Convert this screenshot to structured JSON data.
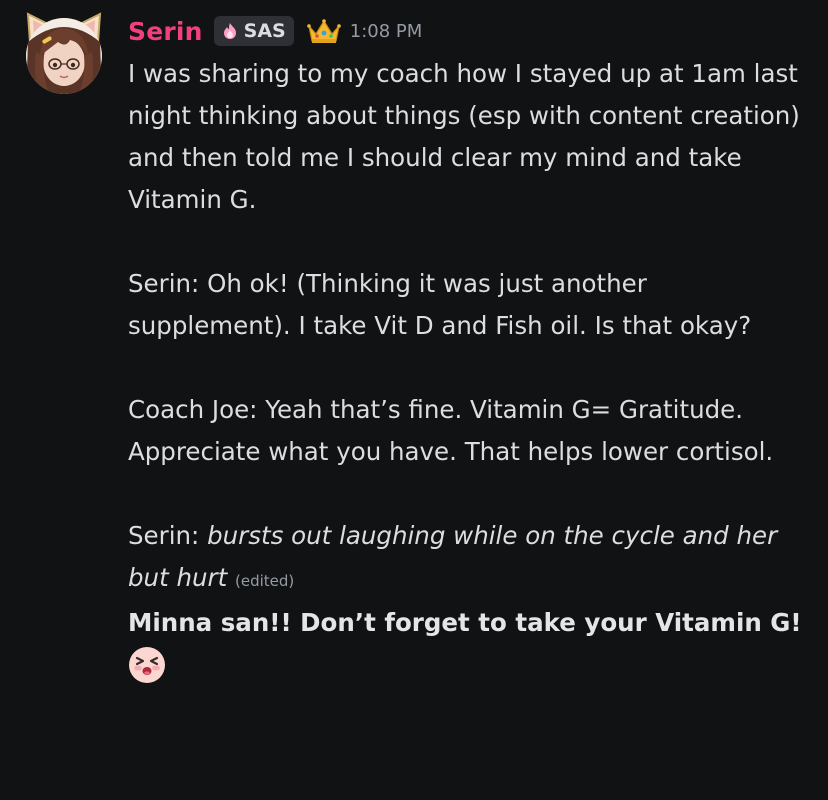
{
  "author": {
    "name": "Serin",
    "tag": "SAS",
    "timestamp": "1:08 PM",
    "avatar_icon": "anime-girl-cat-ears-avatar",
    "tag_icon": "pink-flame-icon",
    "badge_icon": "crown-icon",
    "name_color": "#f23f7d"
  },
  "message": {
    "paragraph1": "I was sharing to my coach how I stayed up at 1am last night thinking about things (esp with content creation) and then told me I should clear my mind and take Vitamin G.",
    "paragraph2": "Serin: Oh ok! (Thinking it was just another supplement). I take Vit D and Fish oil. Is that okay?",
    "paragraph3": "Coach Joe: Yeah that’s fine. Vitamin G= Gratitude. Appreciate what you have. That helps lower cortisol.",
    "paragraph4_prefix": "Serin: ",
    "paragraph4_action": "bursts out laughing while on the cycle and her but hurt",
    "edited_label": "(edited)",
    "follow_up": "Minna san!! Don’t forget to take your Vitamin G!",
    "follow_up_emoji": "shouting-face-emoji"
  }
}
